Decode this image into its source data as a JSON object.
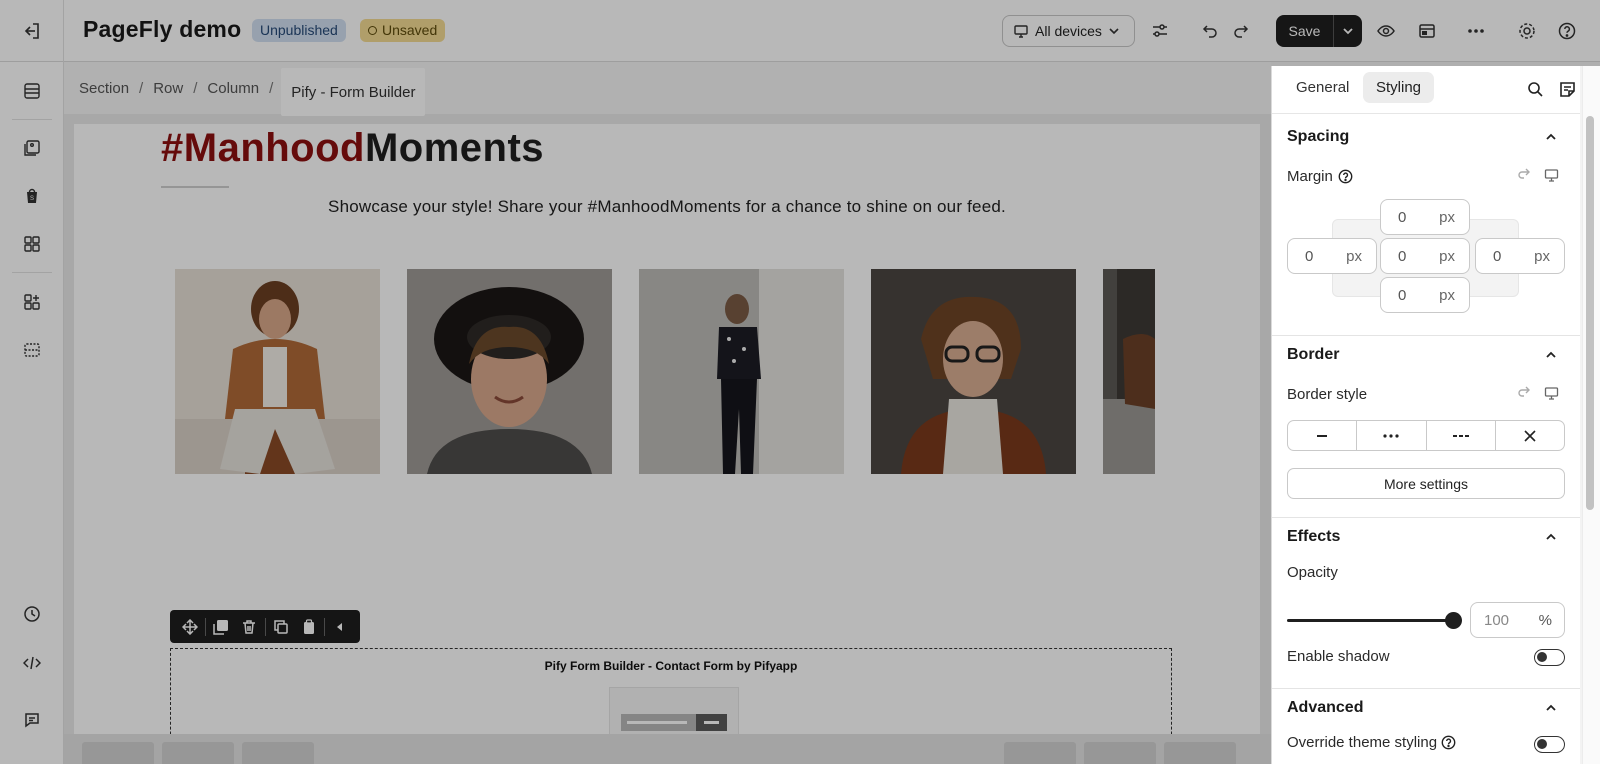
{
  "app": {
    "title": "PageFly demo",
    "status_unpublished": "Unpublished",
    "status_unsaved": "Unsaved",
    "devices_label": "All devices",
    "save_label": "Save"
  },
  "breadcrumb": [
    "Section",
    "Row",
    "Column",
    "Pify - Form Builder"
  ],
  "page": {
    "headline_hash": "#Manhood",
    "headline_rest": "Moments",
    "subtitle": "Showcase your style! Share your #ManhoodMoments for a chance to shine on our feed.",
    "form_title": "Pify Form Builder - Contact Form by Pifyapp"
  },
  "panel": {
    "tab_general": "General",
    "tab_styling": "Styling",
    "spacing": {
      "title": "Spacing",
      "margin_label": "Margin",
      "top": "0",
      "left": "0",
      "center": "0",
      "right": "0",
      "bottom": "0",
      "unit": "px"
    },
    "border": {
      "title": "Border",
      "style_label": "Border style",
      "more_settings": "More settings"
    },
    "effects": {
      "title": "Effects",
      "opacity_label": "Opacity",
      "opacity_value": "100",
      "opacity_unit": "%",
      "opacity_fraction": 1.0,
      "shadow_label": "Enable shadow"
    },
    "advanced": {
      "title": "Advanced",
      "override_label": "Override theme styling"
    }
  },
  "colors": {
    "accent_dark": "#1f1f1f",
    "hashtag_red": "#8c1010",
    "unpublished_bg": "#d2e0f2",
    "unsaved_bg": "#f4dc94"
  }
}
